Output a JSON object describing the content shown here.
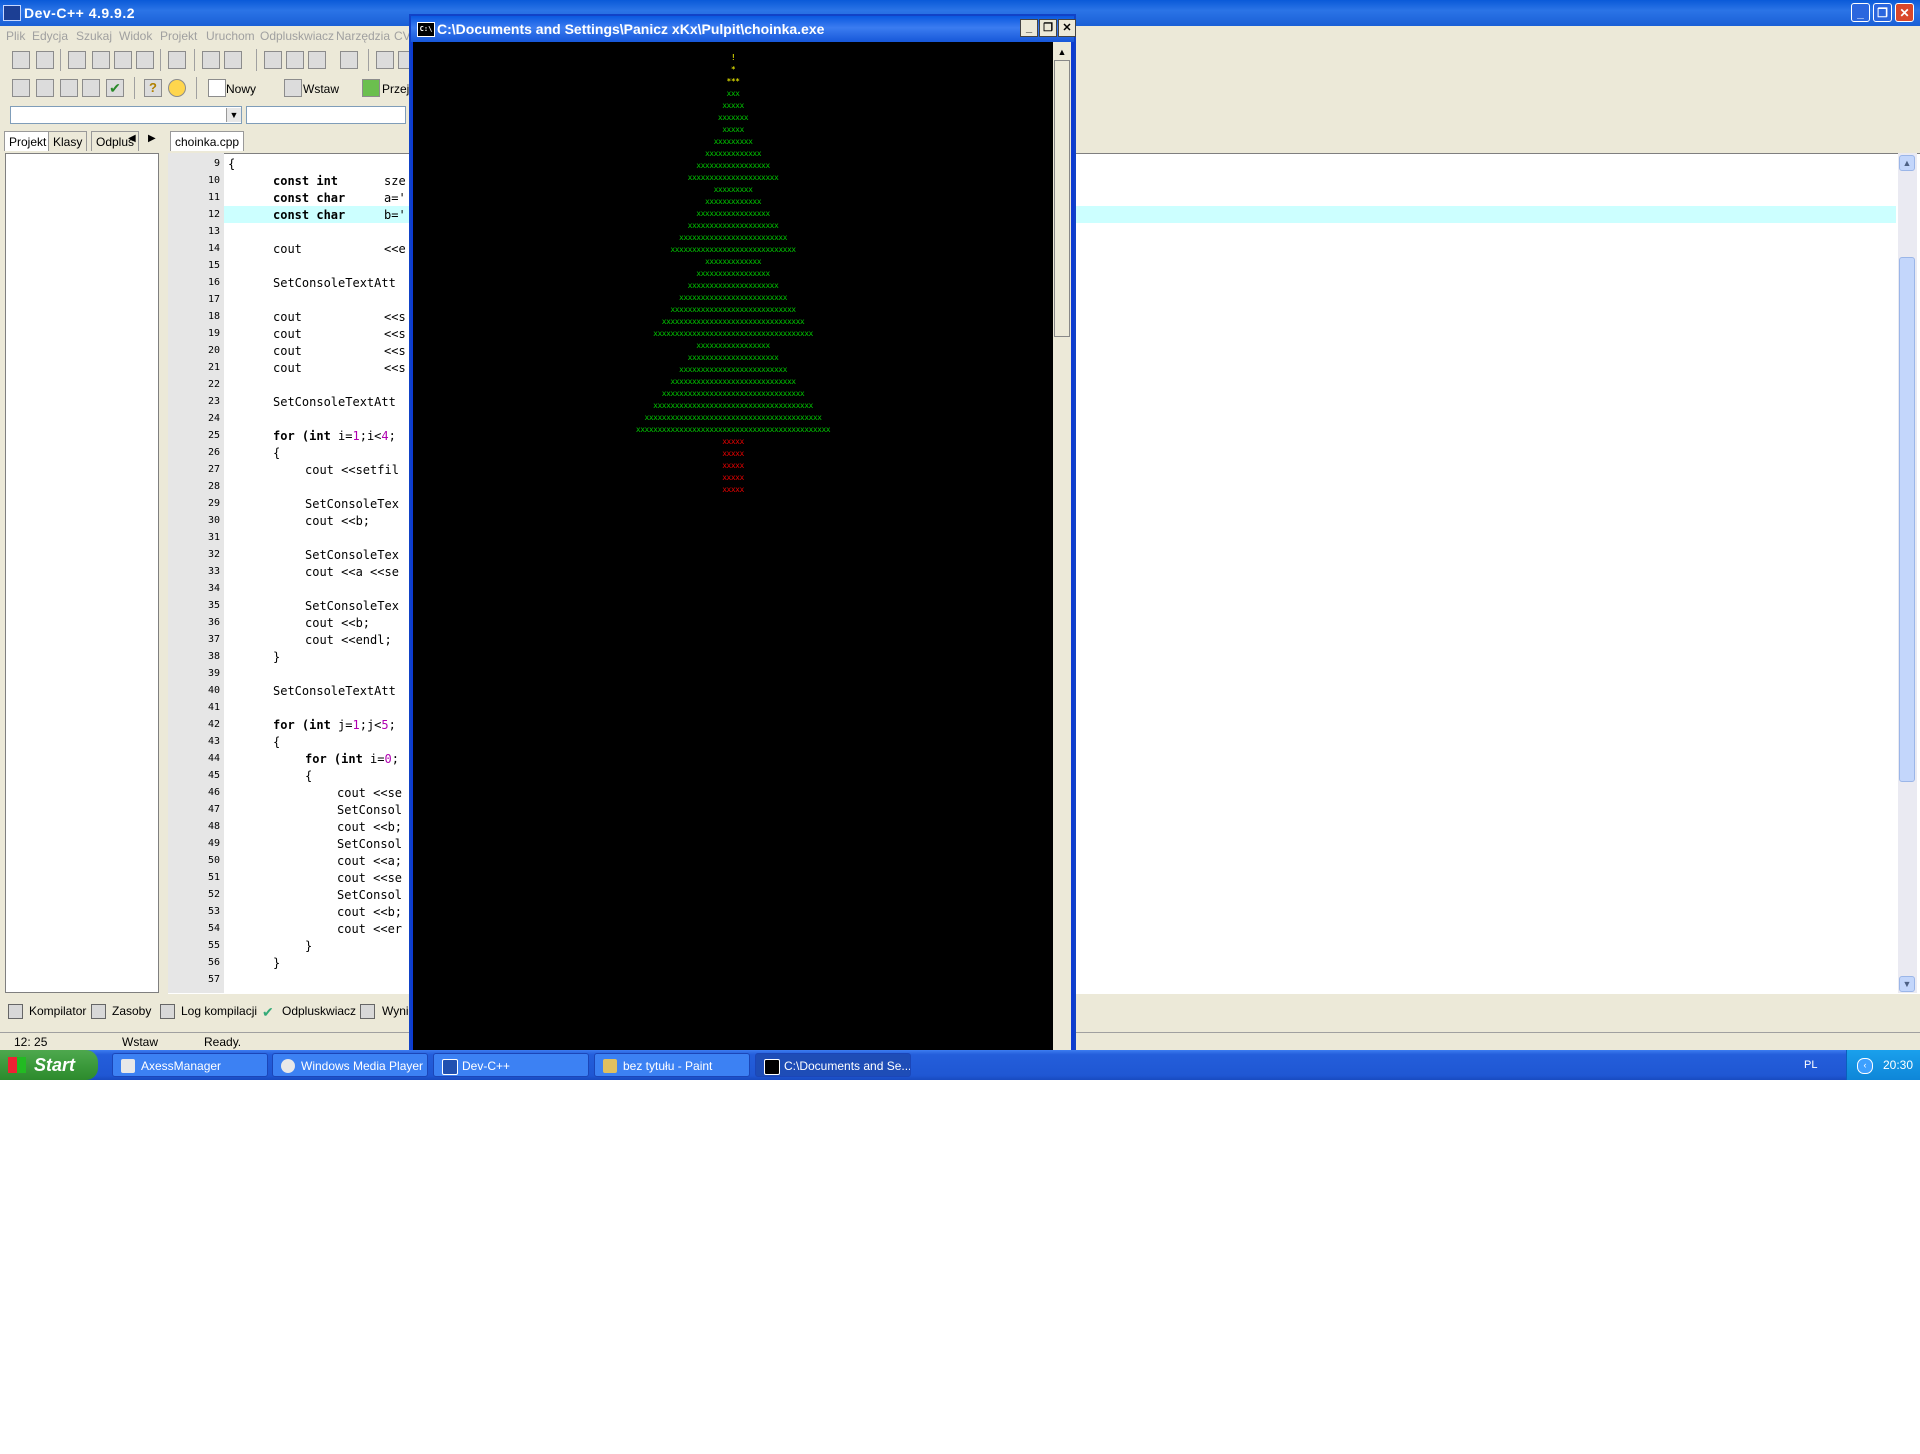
{
  "dev": {
    "title": "Dev-C++ 4.9.9.2",
    "menu": [
      "Plik",
      "Edycja",
      "Szukaj",
      "Widok",
      "Projekt",
      "Uruchom",
      "Odpluskwiacz",
      "Narzędzia",
      "CV"
    ],
    "toolbar2": {
      "new_label": "Nowy",
      "insert_label": "Wstaw",
      "goto_label": "Przej"
    },
    "side_tabs": [
      "Projekt",
      "Klasy",
      "Odplus"
    ],
    "file_tab": "choinka.cpp",
    "bottom_tabs": [
      "Kompilator",
      "Zasoby",
      "Log kompilacji",
      "Odpluskwiacz",
      "Wyni"
    ],
    "status": {
      "position": "12: 25",
      "mode": "Wstaw",
      "state": "Ready."
    }
  },
  "code": {
    "line_numbers": [
      "9",
      "10",
      "11",
      "12",
      "13",
      "14",
      "15",
      "16",
      "17",
      "18",
      "19",
      "20",
      "21",
      "22",
      "23",
      "24",
      "25",
      "26",
      "27",
      "28",
      "29",
      "30",
      "31",
      "32",
      "33",
      "34",
      "35",
      "36",
      "37",
      "38",
      "39",
      "40",
      "41",
      "42",
      "43",
      "44",
      "45",
      "46",
      "47",
      "48",
      "49",
      "50",
      "51",
      "52",
      "53",
      "54",
      "55",
      "56",
      "57"
    ],
    "lines": {
      "l9": "{",
      "l10_kw": "const int",
      "l10_rest": "sze",
      "l11_kw": "const char",
      "l11_rest": "a='",
      "l12_kw": "const char",
      "l12_rest": "b='",
      "l14_a": "cout",
      "l14_b": "<<e",
      "l16": "SetConsoleTextAtt",
      "l18_a": "cout",
      "l18_b": "<<s",
      "l19_a": "cout",
      "l19_b": "<<s",
      "l20_a": "cout",
      "l20_b": "<<s",
      "l21_a": "cout",
      "l21_b": "<<s",
      "l23": "SetConsoleTextAtt",
      "l25_kw": "for (int",
      "l25_rest": " i=",
      "l25_n1": "1",
      "l25_mid": ";i<",
      "l25_n2": "4",
      "l25_end": ";",
      "l26": "{",
      "l27": "cout <<setfil",
      "l29": "SetConsoleTex",
      "l30": "cout <<b;",
      "l32": "SetConsoleTex",
      "l33": "cout <<a <<se",
      "l35": "SetConsoleTex",
      "l36": "cout <<b;",
      "l37": "cout <<endl;",
      "l38": "}",
      "l40": "SetConsoleTextAtt",
      "l42_kw": "for (int",
      "l42_rest": " j=",
      "l42_n1": "1",
      "l42_mid": ";j<",
      "l42_n2": "5",
      "l42_end": ";",
      "l43": "{",
      "l44_kw": "for (int",
      "l44_rest": " i=",
      "l44_n1": "0",
      "l44_end": ";",
      "l45": "{",
      "l46": "cout <<se",
      "l47": "SetConsol",
      "l48": "cout <<b;",
      "l49": "SetConsol",
      "l50": "cout <<a;",
      "l51": "cout <<se",
      "l52": "SetConsol",
      "l53": "cout <<b;",
      "l54": "cout <<er",
      "l55": "}",
      "l56": "}"
    }
  },
  "console": {
    "title": "C:\\Documents and Settings\\Panicz xKx\\Pulpit\\choinka.exe",
    "icon_text": "C:\\",
    "tree": {
      "star": [
        "!",
        "*",
        "***"
      ],
      "rows": [
        "xxx",
        "xxxxx",
        "xxxxxxx",
        "xxxxx",
        "xxxxxxxxx",
        "xxxxxxxxxxxxx",
        "xxxxxxxxxxxxxxxxx",
        "xxxxxxxxxxxxxxxxxxxxx",
        "xxxxxxxxx",
        "xxxxxxxxxxxxx",
        "xxxxxxxxxxxxxxxxx",
        "xxxxxxxxxxxxxxxxxxxxx",
        "xxxxxxxxxxxxxxxxxxxxxxxxx",
        "xxxxxxxxxxxxxxxxxxxxxxxxxxxxx",
        "xxxxxxxxxxxxx",
        "xxxxxxxxxxxxxxxxx",
        "xxxxxxxxxxxxxxxxxxxxx",
        "xxxxxxxxxxxxxxxxxxxxxxxxx",
        "xxxxxxxxxxxxxxxxxxxxxxxxxxxxx",
        "xxxxxxxxxxxxxxxxxxxxxxxxxxxxxxxxx",
        "xxxxxxxxxxxxxxxxxxxxxxxxxxxxxxxxxxxxx",
        "xxxxxxxxxxxxxxxxx",
        "xxxxxxxxxxxxxxxxxxxxx",
        "xxxxxxxxxxxxxxxxxxxxxxxxx",
        "xxxxxxxxxxxxxxxxxxxxxxxxxxxxx",
        "xxxxxxxxxxxxxxxxxxxxxxxxxxxxxxxxx",
        "xxxxxxxxxxxxxxxxxxxxxxxxxxxxxxxxxxxxx",
        "xxxxxxxxxxxxxxxxxxxxxxxxxxxxxxxxxxxxxxxxx",
        "xxxxxxxxxxxxxxxxxxxxxxxxxxxxxxxxxxxxxxxxxxxxx"
      ],
      "trunk": [
        "xxxxx",
        "xxxxx",
        "xxxxx",
        "xxxxx",
        "xxxxx"
      ]
    }
  },
  "taskbar": {
    "start_label": "Start",
    "tasks": [
      "AxessManager",
      "Windows Media Player",
      "Dev-C++",
      "bez tytułu - Paint",
      "C:\\Documents and Se..."
    ],
    "lang": "PL",
    "clock": "20:30"
  },
  "colors": {
    "tree_green": "#00c000",
    "star_yellow": "#ffff00",
    "trunk_red": "#e00000",
    "highlight_line": "#ccffff"
  }
}
